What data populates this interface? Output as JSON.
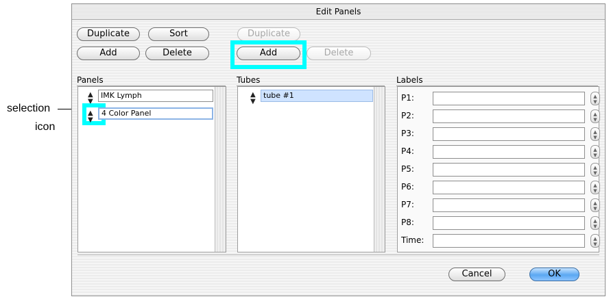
{
  "window": {
    "title": "Edit Panels"
  },
  "panels_buttons": {
    "duplicate": "Duplicate",
    "sort": "Sort",
    "add": "Add",
    "delete": "Delete"
  },
  "tubes_buttons": {
    "duplicate": "Duplicate",
    "add": "Add",
    "delete": "Delete"
  },
  "panels": {
    "label": "Panels",
    "items": [
      {
        "name": "IMK Lymph",
        "icon": "up-down-arrows-icon"
      },
      {
        "name": "4 Color Panel",
        "icon": "up-down-arrows-icon",
        "selected": true
      }
    ]
  },
  "tubes": {
    "label": "Tubes",
    "items": [
      {
        "name": "tube #1",
        "icon": "up-down-arrows-icon",
        "selected": true
      }
    ]
  },
  "labels": {
    "label": "Labels",
    "rows": [
      {
        "name": "P1:",
        "value": ""
      },
      {
        "name": "P2:",
        "value": ""
      },
      {
        "name": "P3:",
        "value": ""
      },
      {
        "name": "P4:",
        "value": ""
      },
      {
        "name": "P5:",
        "value": ""
      },
      {
        "name": "P6:",
        "value": ""
      },
      {
        "name": "P7:",
        "value": ""
      },
      {
        "name": "P8:",
        "value": ""
      },
      {
        "name": "Time:",
        "value": ""
      }
    ]
  },
  "footer": {
    "cancel": "Cancel",
    "ok": "OK"
  },
  "callout": {
    "line1": "selection",
    "line2": "icon"
  },
  "colors": {
    "highlight": "#00ffff",
    "ok_button": "#5ba8f2",
    "selection": "#cfe3ff"
  }
}
